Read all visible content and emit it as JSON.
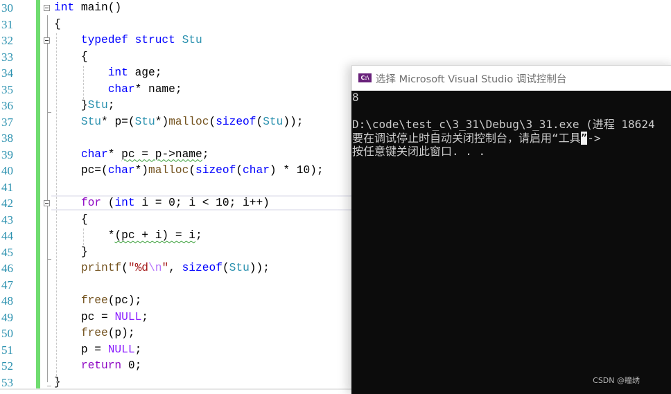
{
  "editor": {
    "line_numbers": [
      "30",
      "31",
      "32",
      "33",
      "34",
      "35",
      "36",
      "37",
      "38",
      "39",
      "40",
      "41",
      "42",
      "43",
      "44",
      "45",
      "46",
      "47",
      "48",
      "49",
      "50",
      "51",
      "52",
      "53"
    ],
    "code": {
      "l30": {
        "kw": "int",
        "rest": " main()"
      },
      "l31": {
        "text": "{"
      },
      "l32": {
        "kw1": "typedef",
        "kw2": "struct",
        "ty": "Stu"
      },
      "l33": {
        "text": "{"
      },
      "l34": {
        "kw": "int",
        "rest": " age;"
      },
      "l35": {
        "kw": "char",
        "rest": "* name;"
      },
      "l36": {
        "brace": "}",
        "ty": "Stu",
        "semi": ";"
      },
      "l37": {
        "ty1": "Stu",
        "p1": "* p=(",
        "ty2": "Stu",
        "p2": "*)",
        "fn": "malloc",
        "p3": "(",
        "kw": "sizeof",
        "p4": "(",
        "ty3": "Stu",
        "p5": "));"
      },
      "l39": {
        "kw": "char",
        "p1": "* ",
        "squig": "pc = p->name",
        "p2": ";"
      },
      "l40": {
        "p1": "pc=(",
        "kw1": "char",
        "p2": "*)",
        "fn": "malloc",
        "p3": "(",
        "kw2": "sizeof",
        "p4": "(",
        "kw3": "char",
        "p5": ") * 10);"
      },
      "l42": {
        "ctl": "for",
        "p1": " (",
        "kw": "int",
        "p2": " i = 0; i < 10; i++)"
      },
      "l43": {
        "text": "{"
      },
      "l44": {
        "p1": "*",
        "squig": "(pc + i) = i",
        "p2": ";"
      },
      "l45": {
        "text": "}"
      },
      "l46": {
        "fn": "printf",
        "p1": "(",
        "str1": "\"%d",
        "esc": "\\n",
        "str2": "\"",
        "p2": ", ",
        "kw": "sizeof",
        "p3": "(",
        "ty": "Stu",
        "p4": "));"
      },
      "l48": {
        "fn": "free",
        "p1": "(pc);"
      },
      "l49": {
        "p1": "pc = ",
        "mac": "NULL",
        "p2": ";"
      },
      "l50": {
        "fn": "free",
        "p1": "(p);"
      },
      "l51": {
        "p1": "p = ",
        "mac": "NULL",
        "p2": ";"
      },
      "l52": {
        "ctl": "return",
        "p1": " 0;"
      },
      "l53": {
        "text": "}"
      }
    }
  },
  "console": {
    "title": "选择 Microsoft Visual Studio 调试控制台",
    "icon": "C:\\",
    "lines": {
      "output": "8",
      "blank": "",
      "exit": "D:\\code\\test_c\\3_31\\Debug\\3_31.exe (进程 18624",
      "hint_a": "要在调试停止时自动关闭控制台，请启用“工具",
      "hint_sel": "”",
      "hint_b": "->",
      "press": "按任意键关闭此窗口. . ."
    }
  },
  "watermark": "CSDN @瞳绣"
}
